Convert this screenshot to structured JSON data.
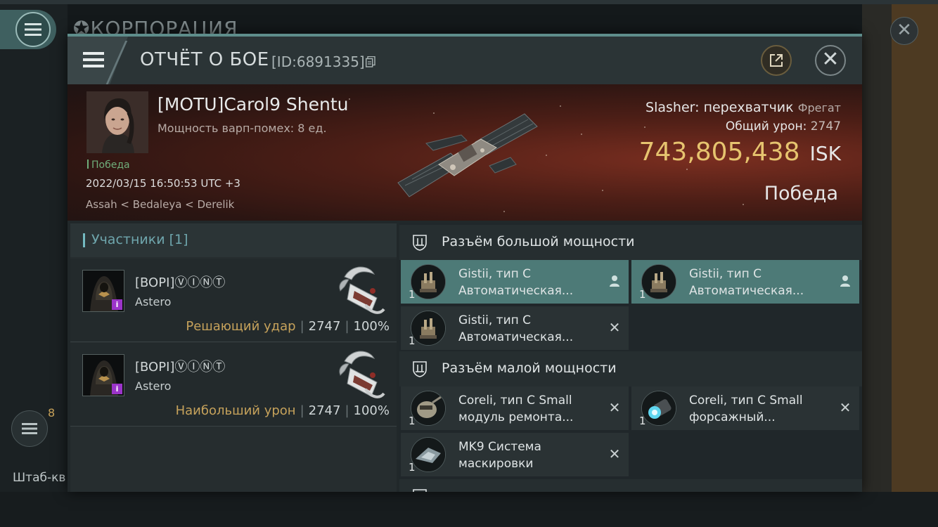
{
  "background": {
    "corp_title": "КОРПОРАЦИЯ",
    "badge_count": "8",
    "hq_label": "Штаб-кв"
  },
  "header": {
    "title": "ОТЧЁТ О БОЕ",
    "report_id": "[ID:6891335]"
  },
  "victim": {
    "name": "[MOTU]Carol9 Shentu",
    "warp_strength": "Мощность варп-помех: 8 ед.",
    "status": "Победа",
    "timestamp": "2022/03/15 16:50:53 UTC +3",
    "location": "Assah < Bedaleya < Derelik",
    "ship": "Slasher: перехватчик",
    "ship_class": "Фрегат",
    "total_damage_label": "Общий урон:",
    "total_damage": "2747",
    "isk_value": "743,805,438",
    "isk_unit": "ISK",
    "result": "Победа"
  },
  "participants": {
    "title": "Участники [1]",
    "rows": [
      {
        "corp": "[BOPI]ⓋⒾⓃⓉ",
        "ship": "Astero",
        "role": "Решающий удар",
        "damage": "2747",
        "percent": "100%"
      },
      {
        "corp": "[BOPI]ⓋⒾⓃⓉ",
        "ship": "Astero",
        "role": "Наибольший урон",
        "damage": "2747",
        "percent": "100%"
      }
    ]
  },
  "fittings": {
    "high_slot_title": "Разъём большой мощности",
    "low_slot_title": "Разъём малой мощности",
    "high": [
      {
        "line1": "Gistii, тип C",
        "line2": "Автоматическая...",
        "qty": "1",
        "state": "person-icon"
      },
      {
        "line1": "Gistii, тип C",
        "line2": "Автоматическая...",
        "qty": "1",
        "state": "person-icon"
      },
      {
        "line1": "Gistii, тип C",
        "line2": "Автоматическая...",
        "qty": "1",
        "state": "destroyed-x"
      }
    ],
    "low": [
      {
        "line1": "Coreli, тип C Small",
        "line2": "модуль ремонта...",
        "qty": "1",
        "state": "destroyed-x"
      },
      {
        "line1": "Coreli, тип C Small",
        "line2": "форсажный...",
        "qty": "1",
        "state": "destroyed-x"
      },
      {
        "line1": "MK9 Система",
        "line2": "маскировки",
        "qty": "1",
        "state": "destroyed-x"
      }
    ]
  },
  "colors": {
    "accent_teal": "#5e8d8b",
    "isk_gold": "#e6c46f",
    "role_gold": "#c6a25b",
    "victory_green": "#6fae7a",
    "highlight_row": "#4d7a77"
  }
}
